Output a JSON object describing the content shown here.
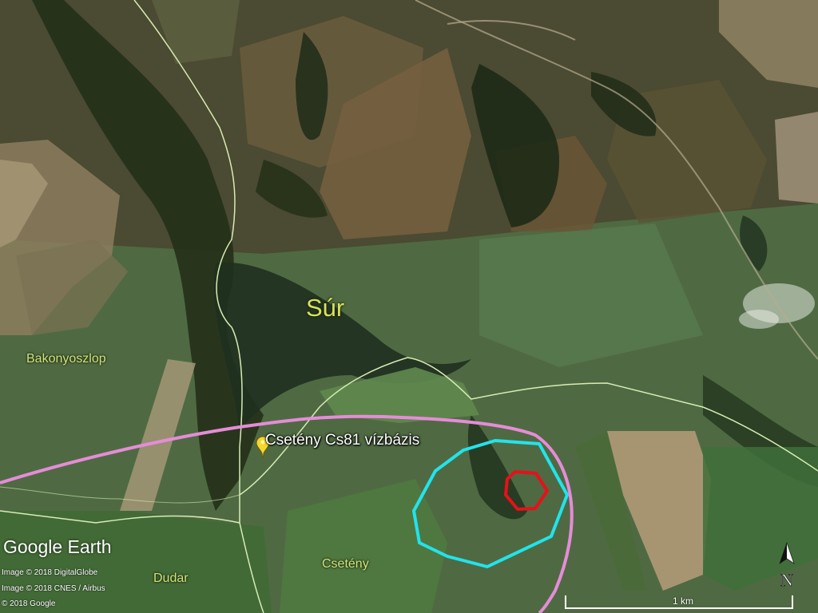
{
  "map": {
    "type": "satellite",
    "app": "Google Earth"
  },
  "places": {
    "sur": "Súr",
    "bakonyoszlop": "Bakonyoszlop",
    "csetenyi": "Csetény",
    "dudar": "Dudar"
  },
  "marker": {
    "label": "Csetény Cs81 vízbázis",
    "icon": "yellow-pushpin-icon"
  },
  "overlays": {
    "outer_zone_color": "#e58cd8",
    "inner_zone_color": "#22e3ec",
    "well_zone_color": "#e8101a",
    "border_color": "#d8ecb4"
  },
  "branding": {
    "logo": "Google Earth"
  },
  "credits": [
    "Image © 2018 DigitalGlobe",
    "Image © 2018 CNES / Airbus",
    "© 2018 Google"
  ],
  "scale": {
    "label": "1 km"
  },
  "compass": {
    "label": "N",
    "icon": "north-arrow-icon"
  }
}
